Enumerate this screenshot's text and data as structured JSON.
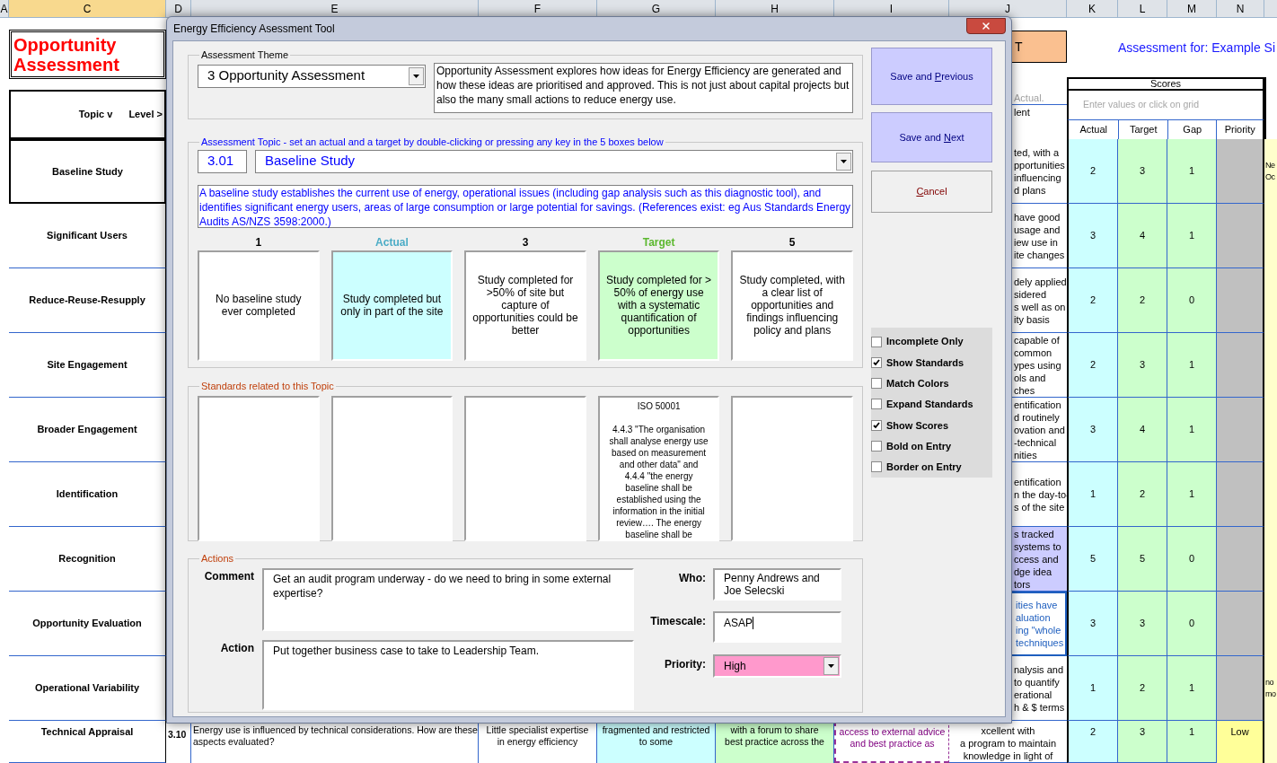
{
  "sheet": {
    "column_headers": [
      {
        "label": "A",
        "selected": false
      },
      {
        "label": "C",
        "selected": true
      },
      {
        "label": "D",
        "selected": false
      },
      {
        "label": "E",
        "selected": false
      },
      {
        "label": "F",
        "selected": false
      },
      {
        "label": "G",
        "selected": false
      },
      {
        "label": "H",
        "selected": false
      },
      {
        "label": "I",
        "selected": false
      },
      {
        "label": "J",
        "selected": false
      },
      {
        "label": "K",
        "selected": false
      },
      {
        "label": "L",
        "selected": false
      },
      {
        "label": "M",
        "selected": false
      },
      {
        "label": "N",
        "selected": false
      }
    ],
    "title": "Opportunity Assessment",
    "header_fragment": "T",
    "assessment_for": "Assessment for: Example Si",
    "topic_header": "Topic v",
    "level_header": "Level >",
    "column_j_fragments": [
      "Actual.",
      "lent"
    ],
    "scores_header": "Scores",
    "scores_hint": "Enter values or click on grid",
    "score_columns": [
      "Actual",
      "Target",
      "Gap",
      "Priority"
    ],
    "rows": [
      {
        "topic": "Baseline Study",
        "selected": true,
        "note": {
          "text": "ted, with a\npportunities\ninfluencing\nd plans",
          "selected": false,
          "color": "#ffffff"
        },
        "actual": "2",
        "target": "3",
        "gap": "1",
        "next_column_text": "Ne\nOc"
      },
      {
        "topic": "Significant Users",
        "selected": false,
        "note": {
          "text": "have good\nusage and\niew use in\nite changes",
          "selected": false,
          "color": "#ffffff"
        },
        "actual": "3",
        "target": "4",
        "gap": "1"
      },
      {
        "topic": "Reduce-Reuse-Resupply",
        "selected": false,
        "note": {
          "text": "dely applied\nsidered\ns well as on\nity basis",
          "selected": false,
          "color": "#ffffff"
        },
        "actual": "2",
        "target": "2",
        "gap": "0"
      },
      {
        "topic": "Site Engagement",
        "selected": false,
        "note": {
          "text": "capable of\ncommon\nypes using\nols and\nches",
          "selected": false,
          "color": "#ffffff"
        },
        "actual": "2",
        "target": "3",
        "gap": "1"
      },
      {
        "topic": "Broader Engagement",
        "selected": false,
        "note": {
          "text": "entification\nd routinely\novation and\n-technical\nnities",
          "selected": false,
          "color": "#ffffff"
        },
        "actual": "3",
        "target": "4",
        "gap": "1"
      },
      {
        "topic": "Identification",
        "selected": false,
        "note": {
          "text": "entification\nn the day-to-\ns of the site",
          "selected": false,
          "color": "#ffffff"
        },
        "actual": "1",
        "target": "2",
        "gap": "1"
      },
      {
        "topic": "Recognition",
        "selected": false,
        "note": {
          "text": "s tracked\nsystems to\nccess and\ndge idea\ntors",
          "selected": false,
          "color": "#ccccff"
        },
        "actual": "5",
        "target": "5",
        "gap": "0"
      },
      {
        "topic": "Opportunity Evaluation",
        "selected": false,
        "note": {
          "text": "ities have\naluation\ning \"whole\ntechniques",
          "selected": true,
          "color": "#ffffff"
        },
        "actual": "3",
        "target": "3",
        "gap": "0"
      },
      {
        "topic": "Operational Variability",
        "selected": false,
        "note": {
          "text": "nalysis and\nto quantify\nerational\nh & $ terms",
          "selected": false,
          "color": "#ffffff"
        },
        "actual": "1",
        "target": "2",
        "gap": "1",
        "next_column_text": "no\nmo"
      },
      {
        "topic": "Technical Appraisal",
        "selected": false,
        "number": "3.10",
        "question": "Energy use is influenced by technical considerations. How are these aspects evaluated?",
        "levels": [
          {
            "kind": "plain",
            "text": "Little specialist expertise\nin energy efficiency"
          },
          {
            "kind": "actual",
            "text": "fragmented and restricted\nto some"
          },
          {
            "kind": "target",
            "text": "with a forum to share\nbest practice across the"
          },
          {
            "kind": "dashed",
            "text": "access to external advice\nand best practice as"
          }
        ],
        "note": {
          "text": "xcellent with\na program to maintain\nknowledge in light of",
          "selected": false,
          "color": "#ffffff"
        },
        "actual": "2",
        "target": "3",
        "gap": "1",
        "priority": "Low",
        "color": "#ffff99"
      }
    ]
  },
  "dialog": {
    "title": "Energy Efficiency Asessment Tool",
    "theme": {
      "legend": "Assessment Theme",
      "value": "3 Opportunity Assessment",
      "description": "Opportunity Assessment explores how ideas for Energy Efficiency are generated and how these ideas are prioritised and  approved. This is not just about capital projects but also the many small actions to reduce energy use."
    },
    "topic": {
      "legend": "Assessment Topic - set an actual and a target by double-clicking or pressing any key in the 5 boxes below",
      "code": "3.01",
      "value": "Baseline Study",
      "description": "A baseline study establishes the current use of energy, operational issues (including gap analysis such as this diagnostic tool), and identifies significant energy users, areas of large consumption or large potential for savings. (References exist: eg Aus Standards Energy Audits AS/NZS 3598:2000.)",
      "levels": [
        {
          "label": "1",
          "kind": "plain",
          "text": "No baseline study ever completed"
        },
        {
          "label": "Actual",
          "kind": "actual",
          "text": "Study completed but only in part of the site"
        },
        {
          "label": "3",
          "kind": "plain",
          "text": "Study completed for >50% of site but capture of opportunities could be better"
        },
        {
          "label": "Target",
          "kind": "target",
          "text": "Study completed for > 50% of energy use with a systematic quantification of opportunities"
        },
        {
          "label": "5",
          "kind": "plain",
          "text": "Study completed, with a clear list of opportunities and findings influencing policy and plans"
        }
      ]
    },
    "standards": {
      "legend": "Standards related to this Topic",
      "boxes": [
        {
          "kind": "empty"
        },
        {
          "kind": "empty"
        },
        {
          "kind": "empty"
        },
        {
          "kind": "text",
          "text": "ISO 50001\n\n4.4.3 \"The organisation\nshall analyse energy use\nbased on measurement\nand other data\" and\n4.4.4 \"the energy\nbaseline shall be\nestablished using the\ninformation in the initial\nreview…. The energy\nbaseline shall be"
        },
        {
          "kind": "empty"
        }
      ]
    },
    "actions": {
      "legend": "Actions",
      "comment_label": "Comment",
      "comment": "Get an audit program underway - do we need to bring in some external expertise?",
      "action_label": "Action",
      "action": "Put together business case to take to Leadership Team.",
      "who_label": "Who:",
      "who": "Penny Andrews and Joe Selecski",
      "timescale_label": "Timescale:",
      "timescale": "ASAP",
      "priority_label": "Priority:",
      "priority": "High",
      "color": "#ff99cc"
    },
    "buttons": [
      {
        "kind": "save",
        "before": "Save and ",
        "key": "P",
        "after": "revious"
      },
      {
        "kind": "save",
        "before": "Save and ",
        "key": "N",
        "after": "ext"
      },
      {
        "kind": "cancel",
        "key": "C",
        "after": "ancel"
      }
    ],
    "options": [
      {
        "label": "Incomplete Only",
        "checked": false
      },
      {
        "label": "Show Standards",
        "checked": true
      },
      {
        "label": "Match Colors",
        "checked": false
      },
      {
        "label": "Expand Standards",
        "checked": false
      },
      {
        "label": "Show Scores",
        "checked": true
      },
      {
        "label": "Bold on Entry",
        "checked": false
      },
      {
        "label": "Border on Entry",
        "checked": false
      }
    ]
  }
}
